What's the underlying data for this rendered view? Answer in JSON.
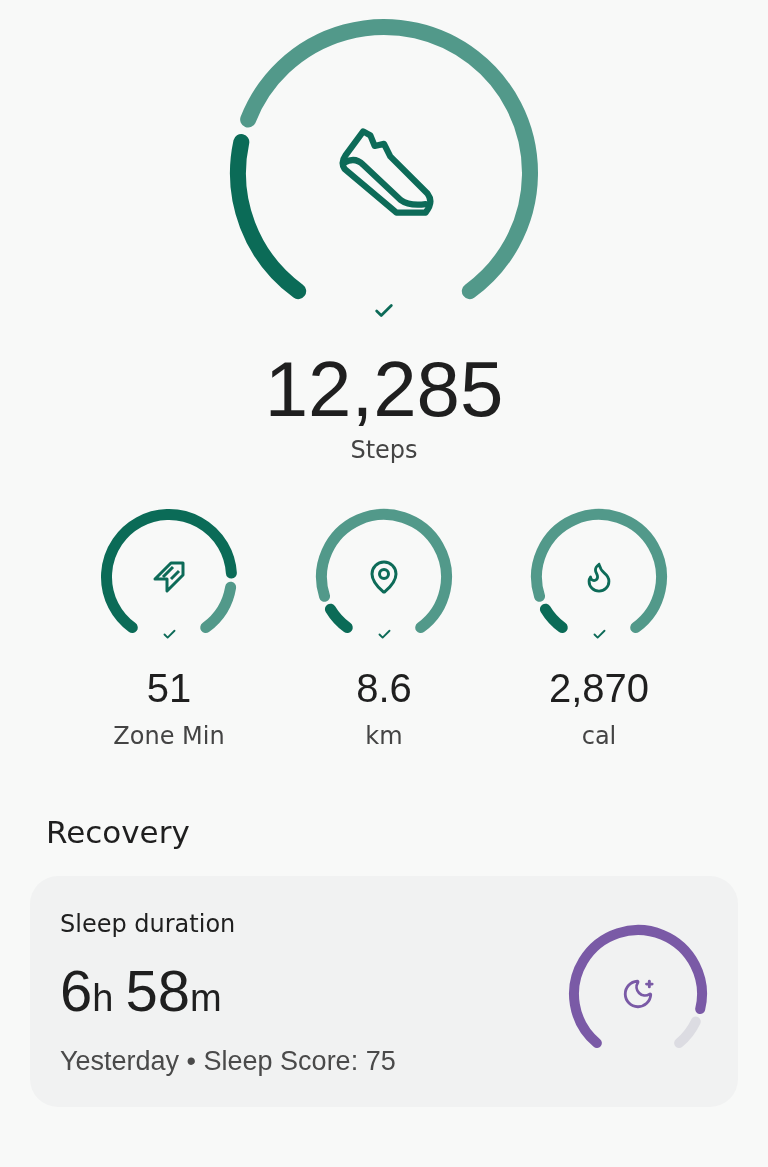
{
  "steps": {
    "value": "12,285",
    "label": "Steps",
    "goal_met": true
  },
  "metrics": [
    {
      "kind": "zone",
      "value": "51",
      "label": "Zone Min",
      "goal_met": true
    },
    {
      "kind": "distance",
      "value": "8.6",
      "label": "km",
      "goal_met": true
    },
    {
      "kind": "calories",
      "value": "2,870",
      "label": "cal",
      "goal_met": true
    }
  ],
  "recovery": {
    "heading": "Recovery",
    "card": {
      "title": "Sleep duration",
      "hours": "6",
      "hours_unit": "h",
      "minutes": "58",
      "minutes_unit": "m",
      "subtitle": "Yesterday • Sleep Score: 75"
    }
  }
}
